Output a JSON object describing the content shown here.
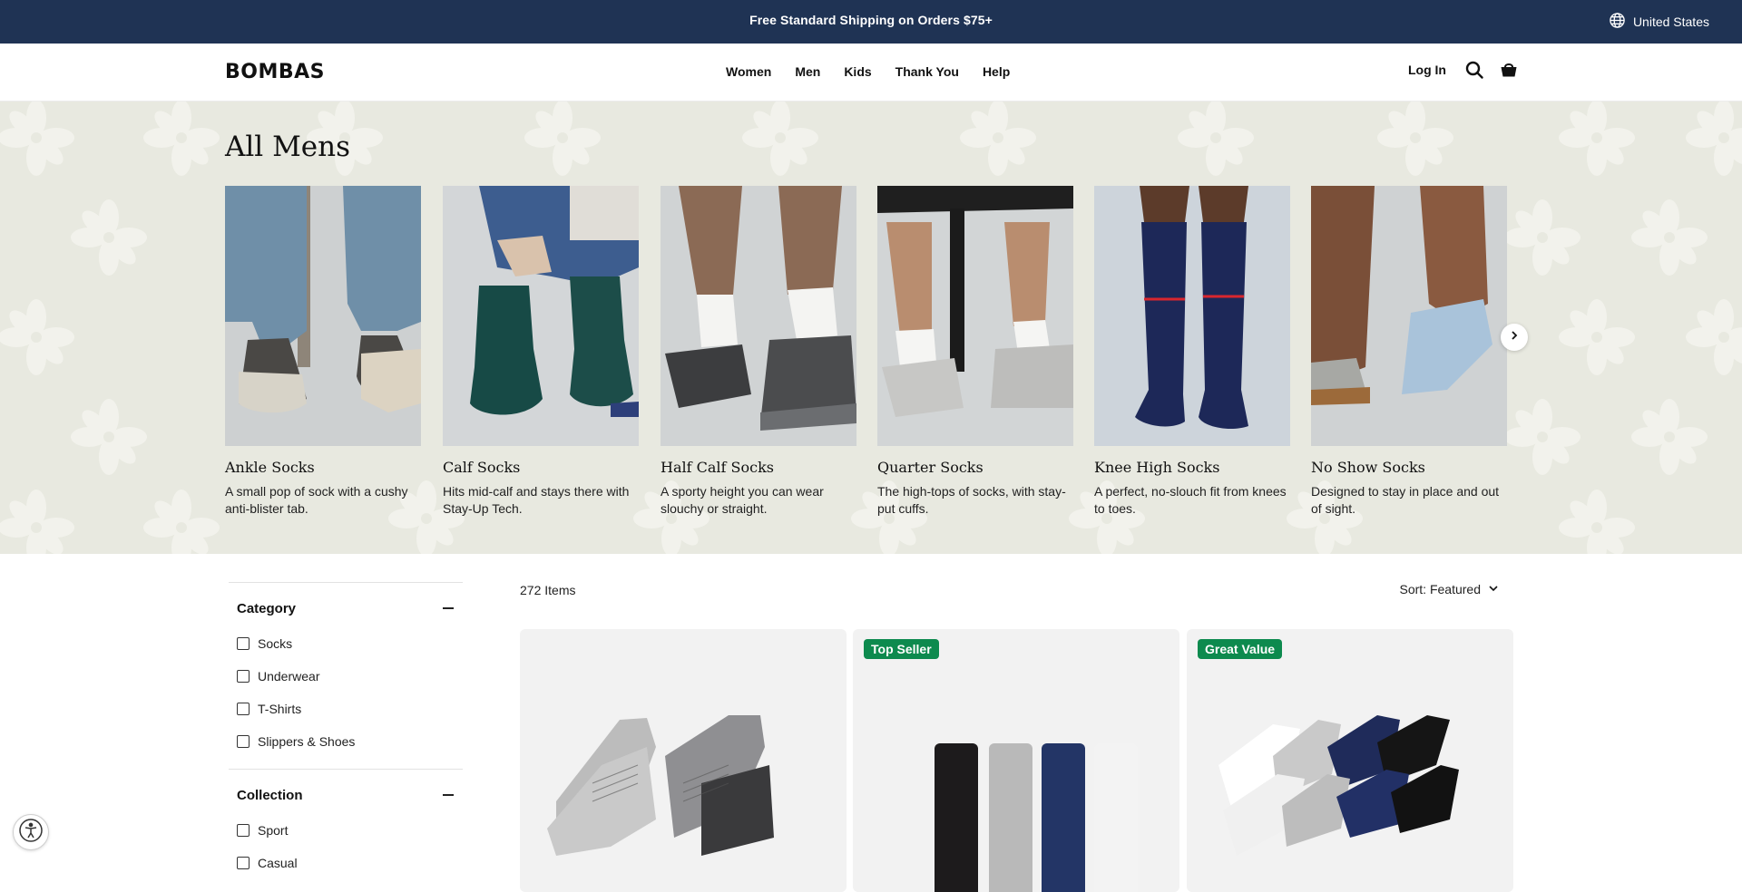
{
  "announcement": {
    "message": "Free Standard Shipping on Orders $75+",
    "region": "United States"
  },
  "header": {
    "logo": "BOMBAS",
    "nav": [
      "Women",
      "Men",
      "Kids",
      "Thank You",
      "Help"
    ],
    "login": "Log In"
  },
  "hero": {
    "title": "All Mens",
    "background_color": "#e8e9e0",
    "cards": [
      {
        "title": "Ankle Socks",
        "description": "A small pop of sock with a cushy anti-blister tab."
      },
      {
        "title": "Calf Socks",
        "description": "Hits mid-calf and stays there with Stay-Up Tech."
      },
      {
        "title": "Half Calf Socks",
        "description": "A sporty height you can wear slouchy or straight."
      },
      {
        "title": "Quarter Socks",
        "description": "The high-tops of socks, with stay-put cuffs."
      },
      {
        "title": "Knee High Socks",
        "description": "A perfect, no-slouch fit from knees to toes."
      },
      {
        "title": "No Show Socks",
        "description": "Designed to stay in place and out of sight."
      }
    ]
  },
  "filters": {
    "groups": [
      {
        "title": "Category",
        "options": [
          "Socks",
          "Underwear",
          "T-Shirts",
          "Slippers & Shoes"
        ]
      },
      {
        "title": "Collection",
        "options": [
          "Sport",
          "Casual"
        ]
      }
    ]
  },
  "listing": {
    "count": "272 Items",
    "sort": "Sort: Featured"
  },
  "products": [
    {
      "badge": ""
    },
    {
      "badge": "Top Seller"
    },
    {
      "badge": "Great Value"
    }
  ],
  "colors": {
    "announcement_bg": "#1f3354",
    "badge_green": "#0d8a4e"
  }
}
